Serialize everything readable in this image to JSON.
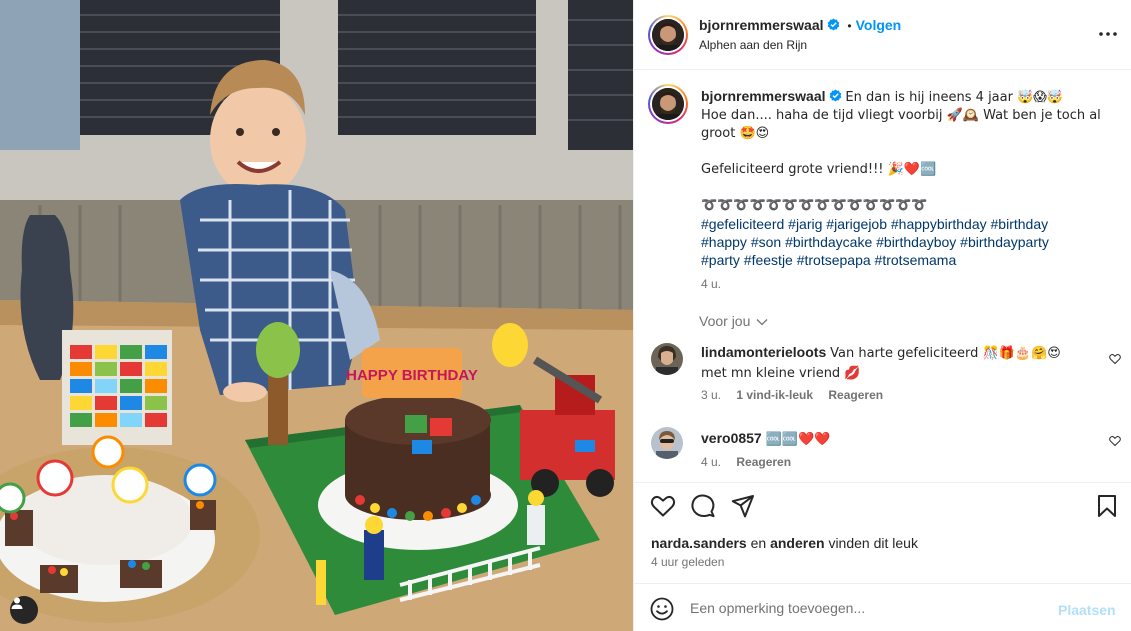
{
  "post": {
    "author": "bjornremmerswaal",
    "follow_label": "Volgen",
    "separator": "•",
    "location": "Alphen aan den Rijn",
    "caption_lines": [
      "En dan is hij ineens 4 jaar 🤯😱🤯",
      "Hoe dan.... haha de tijd vliegt voorbij 🚀🕰️ Wat ben je toch al",
      "groot 🤩😍",
      "Gefeliciteerd grote vriend!!! 🎉❤️🆒",
      "➰➰➰➰➰➰➰➰➰➰➰➰➰➰"
    ],
    "hashtag_lines": [
      "#gefeliciteerd #jarig #jarigejob #happybirthday #birthday",
      "#happy #son #birthdaycake #birthdayboy #birthdayparty",
      "#party #feestje #trotsepapa #trotsemama"
    ],
    "caption_time": "4 u."
  },
  "voor_jou": "Voor jou",
  "comments": [
    {
      "user": "lindamonterieloots",
      "text_line1": "Van harte gefeliciteerd 🎊🎁🎂🤗😍",
      "text_line2": "met mn kleine vriend 💋",
      "time": "3 u.",
      "likes": "1 vind-ik-leuk",
      "reply": "Reageren"
    },
    {
      "user": "vero0857",
      "text_line1": "🆒🆒❤️❤️",
      "time": "4 u.",
      "reply": "Reageren"
    }
  ],
  "likes_line": {
    "user": "narda.sanders",
    "connector": "en",
    "others": "anderen",
    "suffix": "vinden dit leuk"
  },
  "posted_ago": "4 uur geleden",
  "composer": {
    "placeholder": "Een opmerking toevoegen...",
    "post_label": "Plaatsen"
  },
  "photo": {
    "topper_text": "HAPPY BIRTHDAY"
  },
  "colors": {
    "accent": "#0095f6",
    "hashtag": "#00376b",
    "verified": "#0095f6",
    "muted": "#737373"
  }
}
